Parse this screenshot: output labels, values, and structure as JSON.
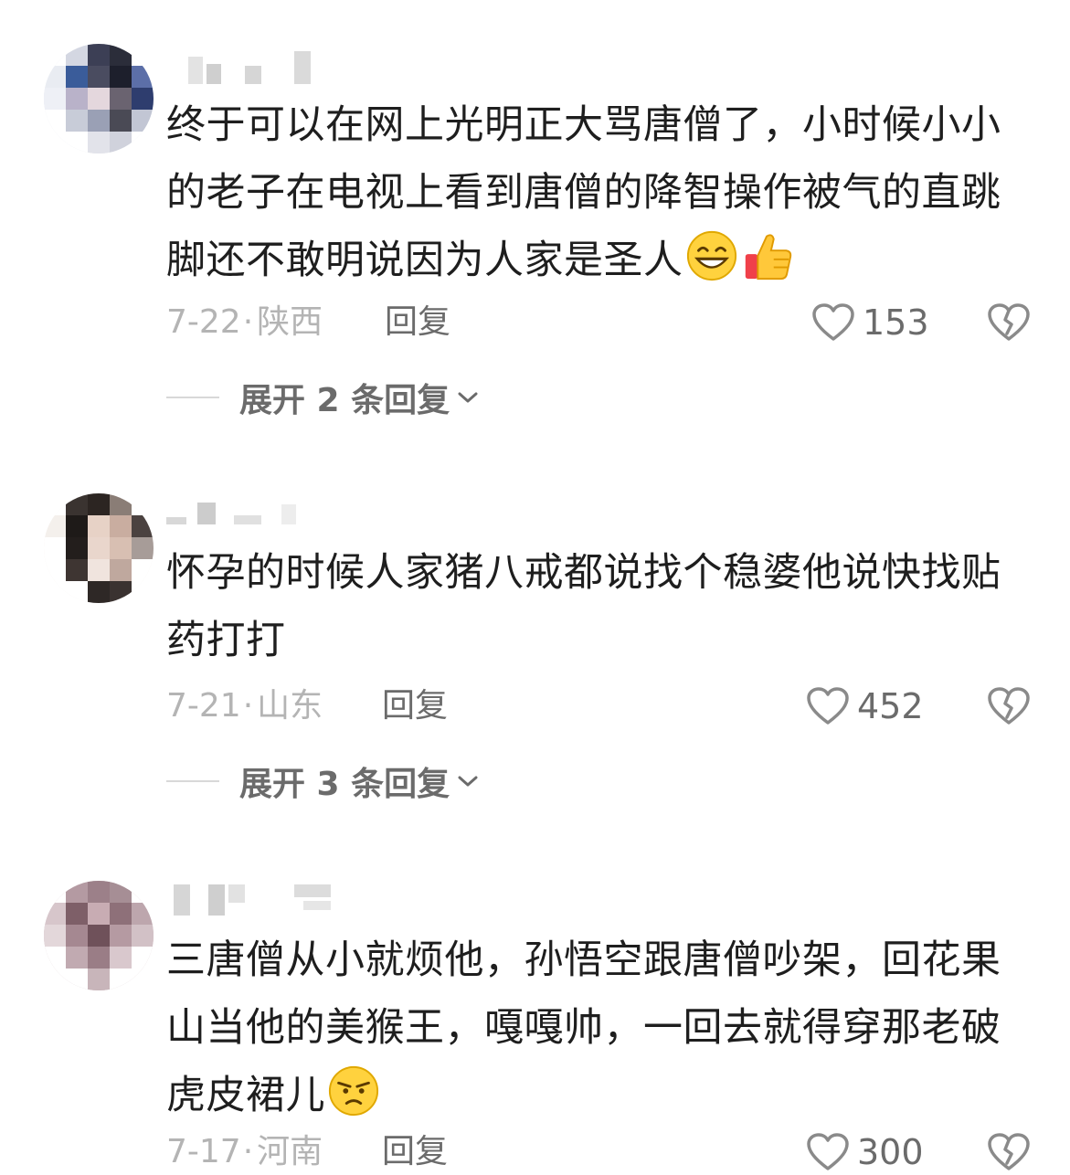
{
  "comments": [
    {
      "text": "终于可以在网上光明正大骂唐僧了，小时候小小的老子在电视上看到唐僧的降智操作被气的直跳脚还不敢明说因为人家是圣人",
      "emojis": [
        "grin-emoji",
        "thumbs-up-emoji"
      ],
      "date": "7-22",
      "separator": "·",
      "location": "陕西",
      "reply_label": "回复",
      "likes": "153",
      "expand_label": "展开 2 条回复"
    },
    {
      "text": "怀孕的时候人家猪八戒都说找个稳婆他说快找贴药打打",
      "emojis": [],
      "date": "7-21",
      "separator": "·",
      "location": "山东",
      "reply_label": "回复",
      "likes": "452",
      "expand_label": "展开 3 条回复"
    },
    {
      "text": "三唐僧从小就烦他，孙悟空跟唐僧吵架，回花果山当他的美猴王，嘎嘎帅，一回去就得穿那老破虎皮裙儿",
      "emojis": [
        "annoyed-emoji"
      ],
      "date": "7-17",
      "separator": "·",
      "location": "河南",
      "reply_label": "回复",
      "likes": "300"
    }
  ],
  "colors": {
    "text": "#1e1e1e",
    "meta": "#b4b4b4",
    "action": "#6b6b6b"
  }
}
